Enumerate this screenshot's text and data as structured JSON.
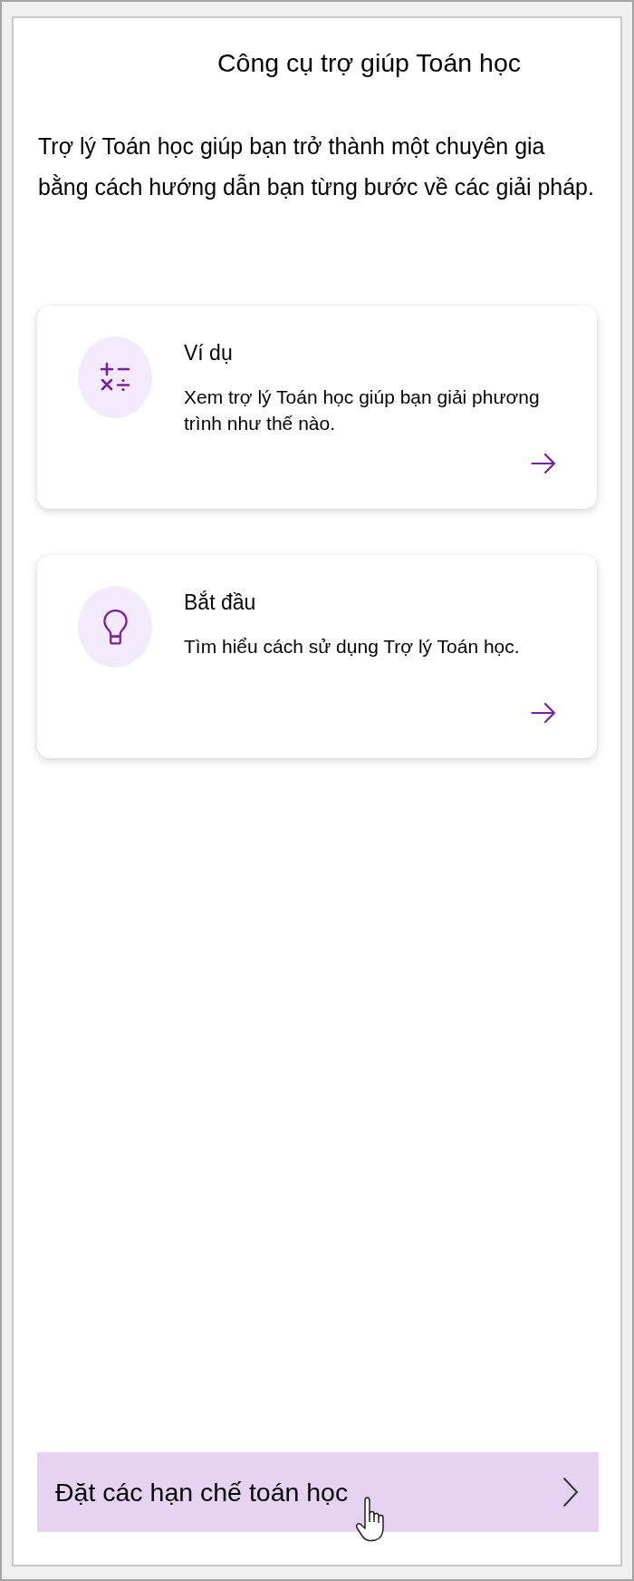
{
  "title": "Công cụ trợ giúp Toán học",
  "intro": "Trợ lý Toán học giúp bạn trở thành một chuyên gia bằng cách hướng dẫn bạn từng bước về các giải pháp.",
  "cards": [
    {
      "kind": "math",
      "title": "Ví dụ",
      "description": "Xem trợ lý Toán học giúp bạn giải phương trình như thế nào."
    },
    {
      "kind": "lightbulb",
      "title": "Bắt đầu",
      "description": "Tìm hiểu cách sử dụng Trợ lý Toán học."
    }
  ],
  "footer_button": {
    "label": "Đặt các hạn chế toán học"
  }
}
